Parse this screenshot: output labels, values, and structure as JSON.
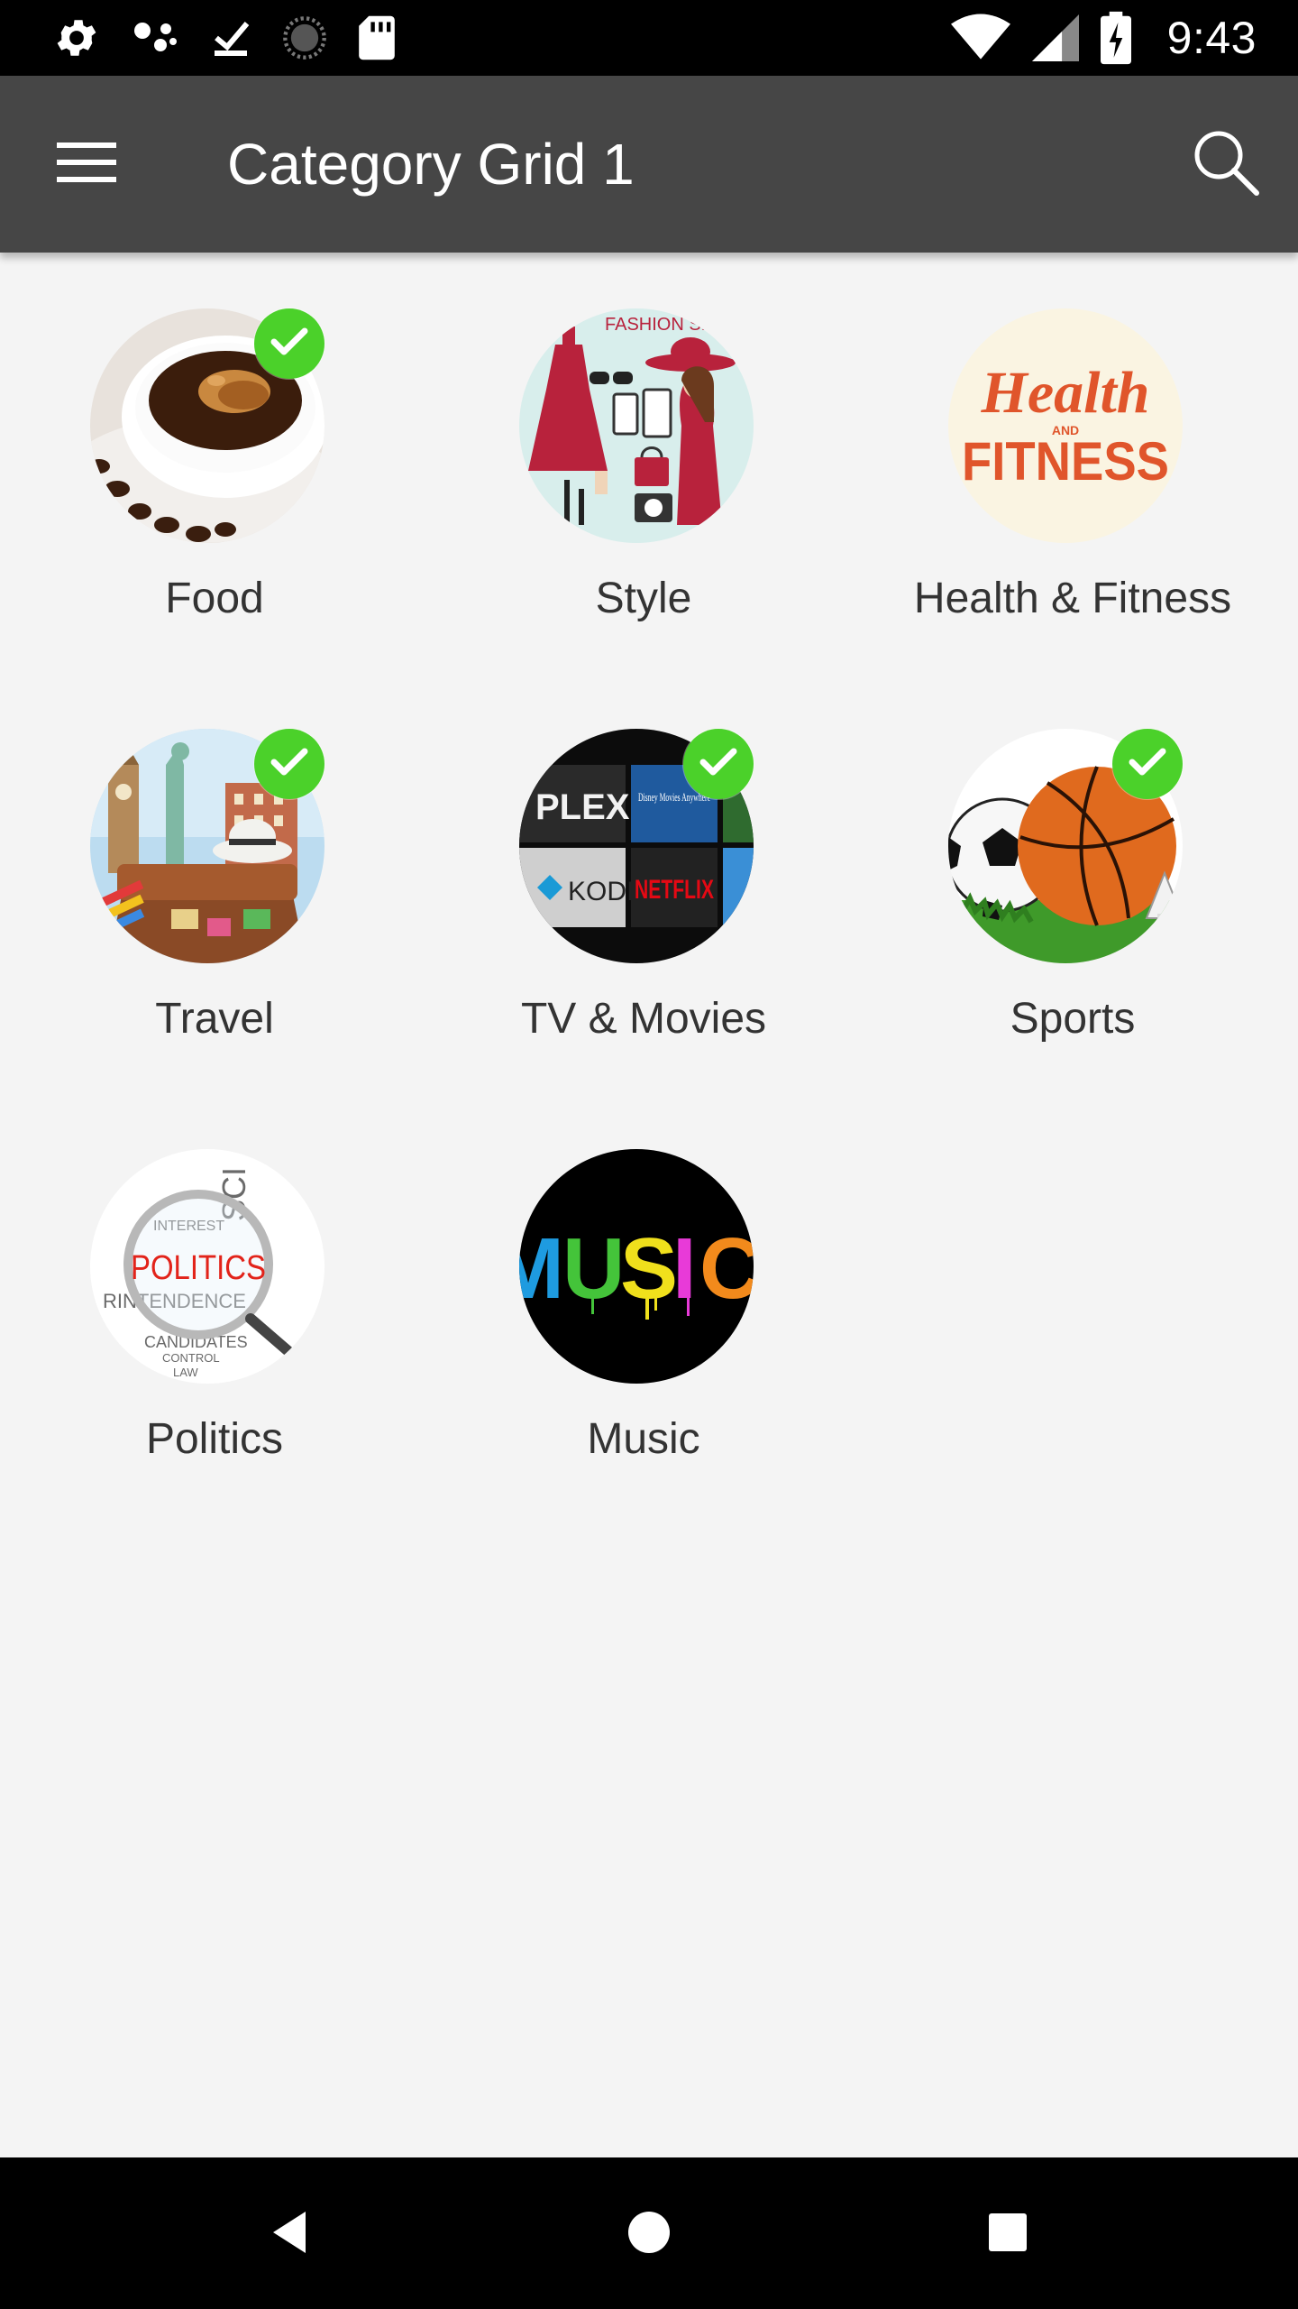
{
  "status_bar": {
    "time": "9:43",
    "left_icons": [
      "settings-icon",
      "assistant-dots-icon",
      "download-done-icon",
      "loading-spinner-icon",
      "sd-card-icon"
    ],
    "right_icons": [
      "wifi-icon",
      "cell-signal-icon",
      "battery-charging-icon"
    ]
  },
  "app_bar": {
    "title": "Category Grid 1",
    "menu_icon": "menu-icon",
    "search_icon": "search-icon"
  },
  "categories": [
    {
      "label": "Food",
      "selected": true,
      "image": "coffee-cup-image"
    },
    {
      "label": "Style",
      "selected": false,
      "image": "fashion-set-image"
    },
    {
      "label": "Health & Fitness",
      "selected": false,
      "image": "health-fitness-logo-image"
    },
    {
      "label": "Travel",
      "selected": true,
      "image": "travel-landmarks-image"
    },
    {
      "label": "TV & Movies",
      "selected": true,
      "image": "streaming-apps-image"
    },
    {
      "label": "Sports",
      "selected": true,
      "image": "sports-balls-image"
    },
    {
      "label": "Politics",
      "selected": false,
      "image": "politics-word-cloud-image"
    },
    {
      "label": "Music",
      "selected": false,
      "image": "music-graffiti-image"
    }
  ],
  "nav_bar": {
    "back_icon": "back-icon",
    "home_icon": "home-icon",
    "recents_icon": "recents-icon"
  },
  "colors": {
    "status_bar": "#000000",
    "app_bar": "#464646",
    "background": "#f4f4f4",
    "check_badge": "#4bd12a",
    "label_text": "#333333"
  },
  "image_text": {
    "style": "FASHION SET",
    "health_line1": "Health",
    "health_line2": "AND",
    "health_line3": "FITNESS",
    "tv_plex": "PLEX",
    "tv_disney": "Disney Movies Anywhere",
    "tv_kodi": "KODI",
    "tv_netflix": "NETFLIX",
    "politics": "POLITICS",
    "politics_sci": "SCI",
    "politics_interest": "INTEREST",
    "politics_intendence": "RINTENDENCE",
    "politics_candidates": "CANDIDATES",
    "politics_control": "CONTROL",
    "politics_law": "LAW",
    "music": "MUSIC"
  }
}
